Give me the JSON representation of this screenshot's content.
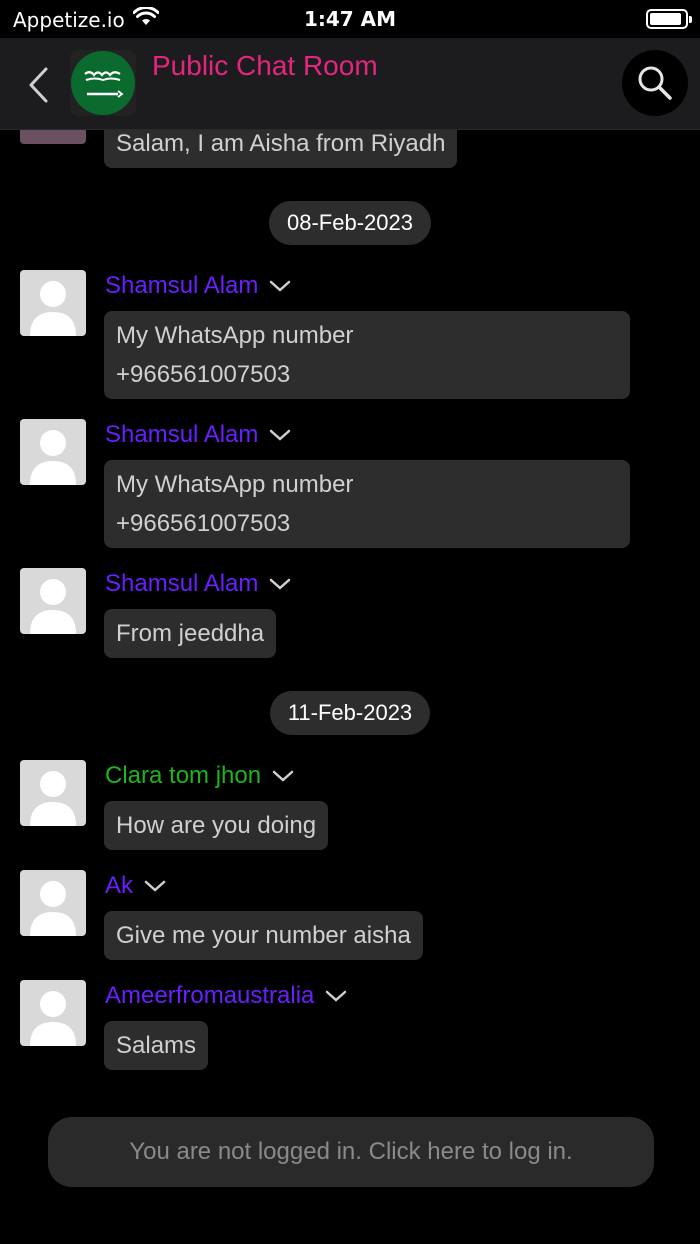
{
  "status_bar": {
    "carrier": "Appetize.io",
    "time": "1:47 AM",
    "battery_level": 0.9
  },
  "header": {
    "title": "Public Chat Room",
    "back_icon": "chevron-left-icon",
    "search_icon": "search-icon",
    "room_avatar": "saudi-flag"
  },
  "colors": {
    "background": "#000000",
    "header_bg": "#1c1c1e",
    "title": "#e3267c",
    "sender_purple": "#6a1fff",
    "sender_green": "#1db41d",
    "bubble_bg": "#2d2d2d",
    "bubble_text": "#d0d0d0"
  },
  "messages": [
    {
      "sender": "",
      "text": "Salam, I am Aisha from Riyadh"
    },
    {
      "date": "08-Feb-2023"
    },
    {
      "sender": "Shamsul Alam",
      "text_line1": "My WhatsApp number",
      "text_line2": "+966561007503"
    },
    {
      "sender": "Shamsul Alam",
      "text_line1": "My WhatsApp number",
      "text_line2": "+966561007503"
    },
    {
      "sender": "Shamsul Alam",
      "text": "From jeeddha"
    },
    {
      "date": "11-Feb-2023"
    },
    {
      "sender": "Clara tom jhon",
      "text": "How are you doing"
    },
    {
      "sender": "Ak",
      "text": "Give me your number aisha"
    },
    {
      "sender": "Ameerfromaustralia",
      "text": "Salams"
    }
  ],
  "login_prompt": "You are not logged in. Click here to log in."
}
